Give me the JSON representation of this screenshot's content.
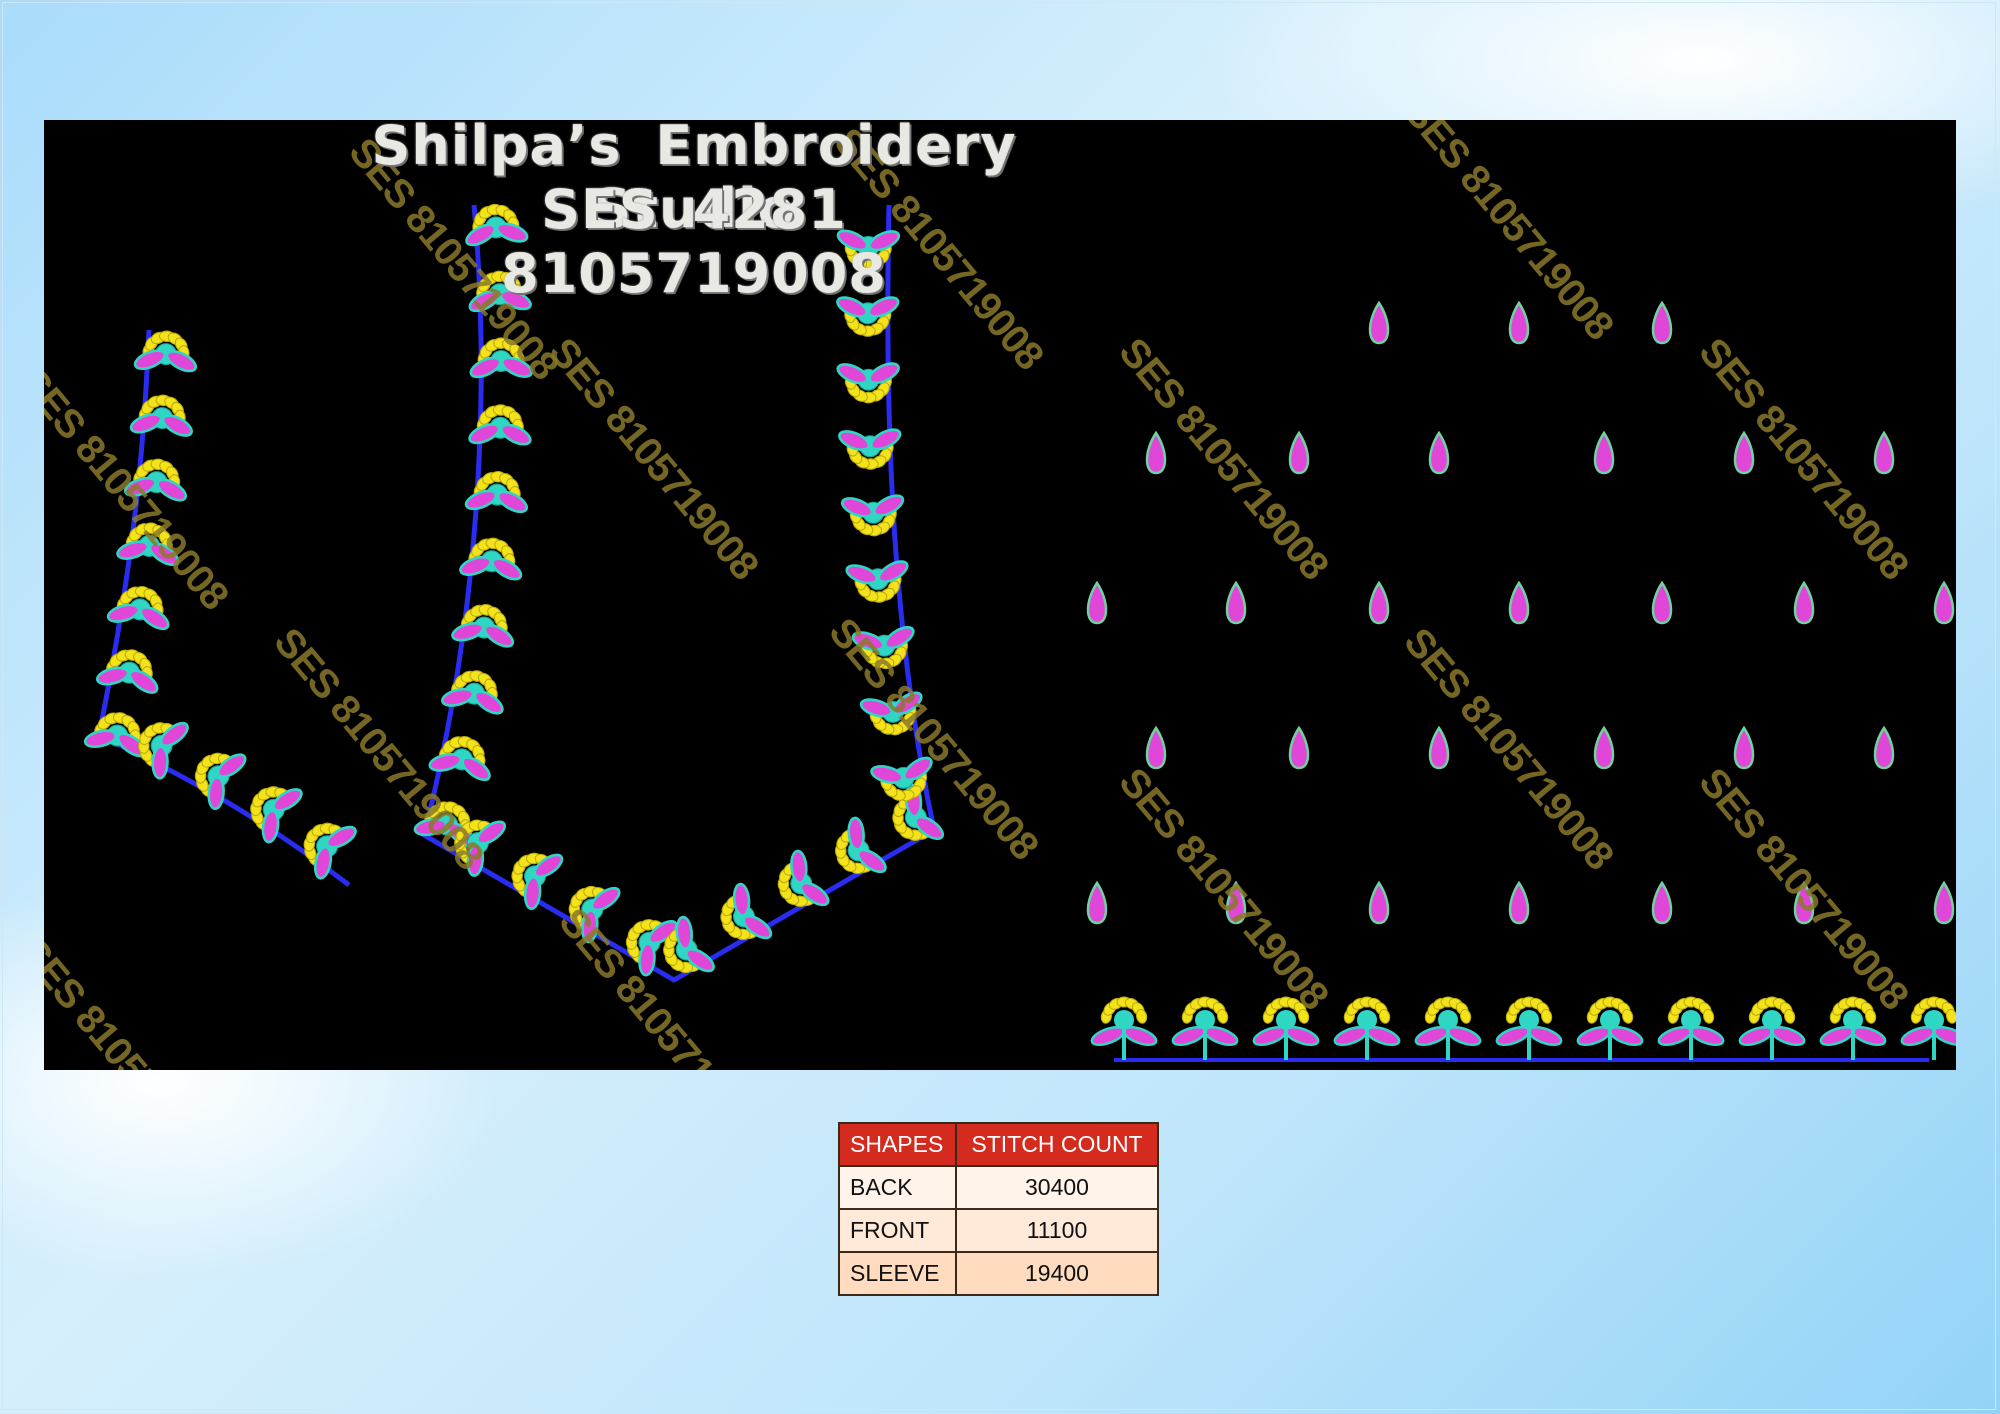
{
  "header": {
    "studio": "Shilpa’s Embroidery Studio",
    "design_code": "SES 4281",
    "phone": "8105719008"
  },
  "watermark": "SES 8105719008",
  "stitch_table": {
    "headers": [
      "SHAPES",
      "STITCH COUNT"
    ],
    "rows": [
      {
        "shape": "BACK",
        "count": "30400"
      },
      {
        "shape": "FRONT",
        "count": "11100"
      },
      {
        "shape": "SLEEVE",
        "count": "19400"
      }
    ]
  },
  "colors": {
    "canvas": "#000000",
    "outline": "#2a2cf0",
    "petal": "#f4e31a",
    "leaf": "#e046d8",
    "core": "#2fd6c4",
    "header_red": "#d52b1e"
  }
}
